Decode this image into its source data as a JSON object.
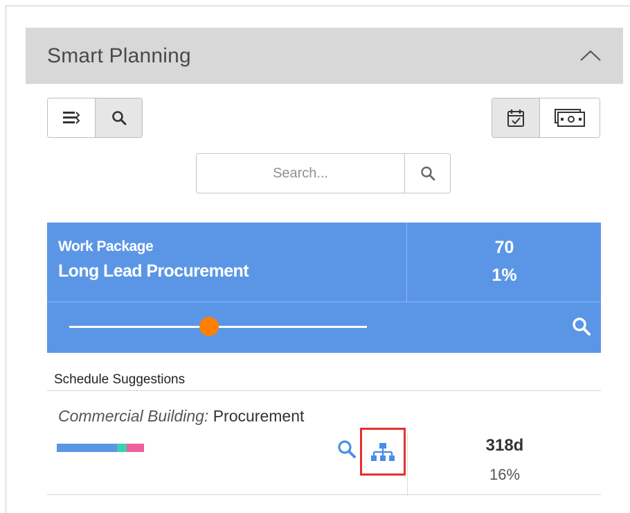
{
  "panel": {
    "title": "Smart Planning",
    "collapse_icon": "chevron-up-icon"
  },
  "toolbar": {
    "left_buttons": [
      {
        "icon": "list-sort-icon",
        "active": false
      },
      {
        "icon": "search-icon",
        "active": true
      }
    ],
    "right_buttons": [
      {
        "icon": "calendar-check-icon",
        "active": true
      },
      {
        "icon": "money-icon",
        "active": false
      }
    ]
  },
  "search": {
    "placeholder": "Search...",
    "value": ""
  },
  "work_package": {
    "label": "Work Package",
    "name": "Long Lead Procurement",
    "count": "70",
    "percent": "1%",
    "slider_position": 0.47,
    "color": "#5b96e6",
    "slider_color": "#ff8000"
  },
  "schedule": {
    "title": "Schedule Suggestions",
    "items": [
      {
        "project": "Commercial Building:",
        "activity": "Procurement",
        "duration": "318d",
        "percent": "16%",
        "bar_segments": [
          {
            "color": "#5b96e6",
            "fraction": 0.69
          },
          {
            "color": "#3ccfb4",
            "fraction": 0.11
          },
          {
            "color": "#f0609a",
            "fraction": 0.2
          }
        ],
        "icons": [
          "search-icon",
          "hierarchy-icon"
        ]
      }
    ]
  },
  "colors": {
    "accent": "#5b96e6",
    "highlight": "#e53030"
  }
}
